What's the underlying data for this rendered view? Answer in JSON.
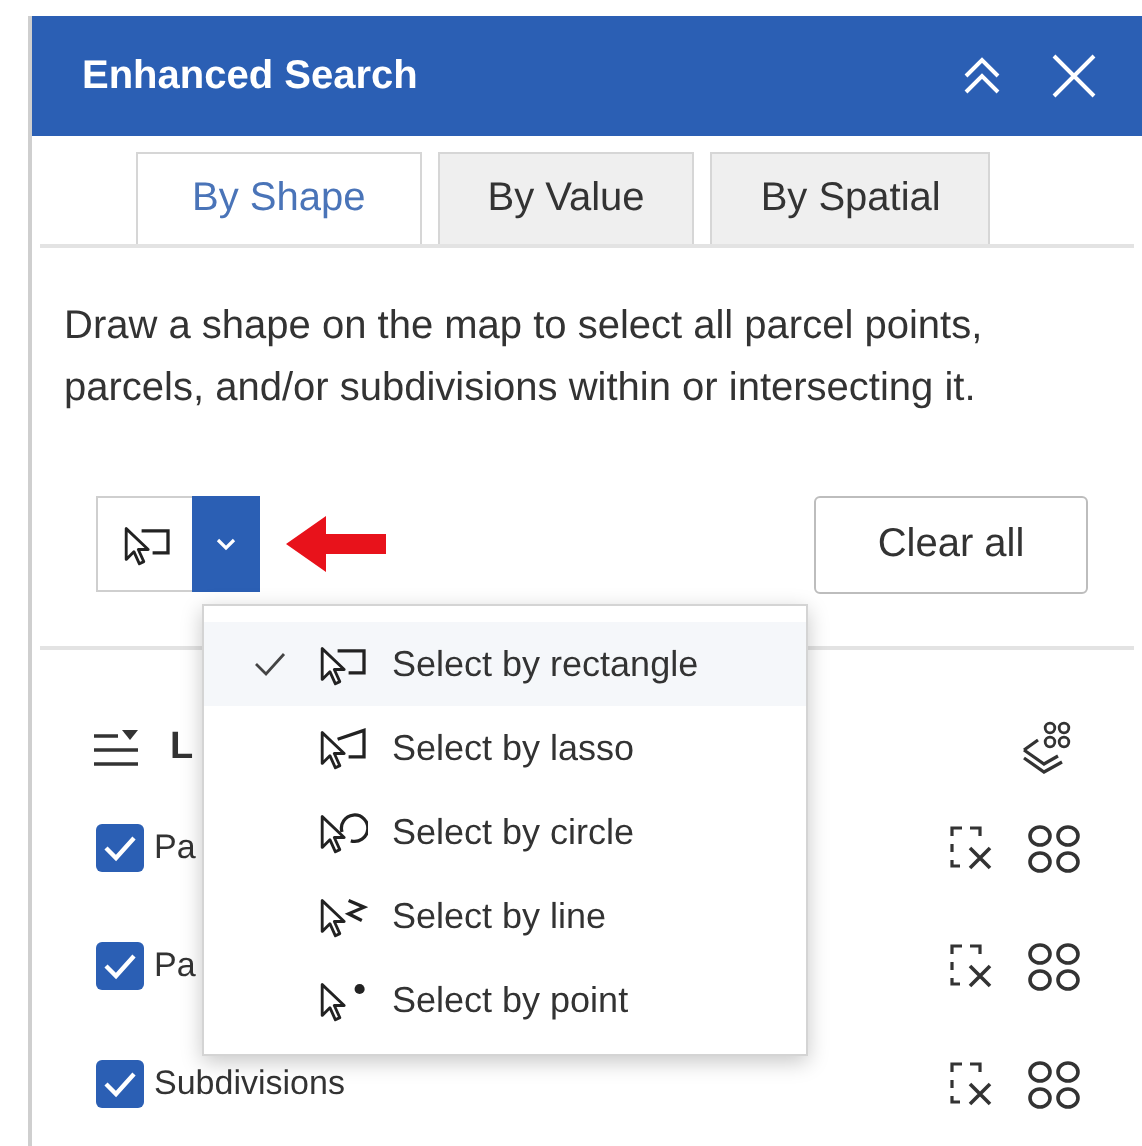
{
  "panel": {
    "title": "Enhanced Search"
  },
  "tabs": [
    {
      "label": "By Shape",
      "selected": true
    },
    {
      "label": "By Value",
      "selected": false
    },
    {
      "label": "By Spatial",
      "selected": false
    }
  ],
  "description": "Draw a shape on the map to select all parcel points, parcels, and/or subdivisions within or intersecting it.",
  "tool_selector": {
    "expanded": true
  },
  "clear_button": "Clear all",
  "layers": {
    "heading": "L",
    "items": [
      {
        "name": "Pa",
        "checked": true
      },
      {
        "name": "Pa",
        "checked": true
      },
      {
        "name": "Subdivisions",
        "checked": true
      }
    ]
  },
  "menu": {
    "items": [
      {
        "label": "Select by rectangle",
        "kind": "rectangle",
        "selected": true
      },
      {
        "label": "Select by lasso",
        "kind": "lasso",
        "selected": false
      },
      {
        "label": "Select by circle",
        "kind": "circle",
        "selected": false
      },
      {
        "label": "Select by line",
        "kind": "line",
        "selected": false
      },
      {
        "label": "Select by point",
        "kind": "point",
        "selected": false
      }
    ]
  }
}
